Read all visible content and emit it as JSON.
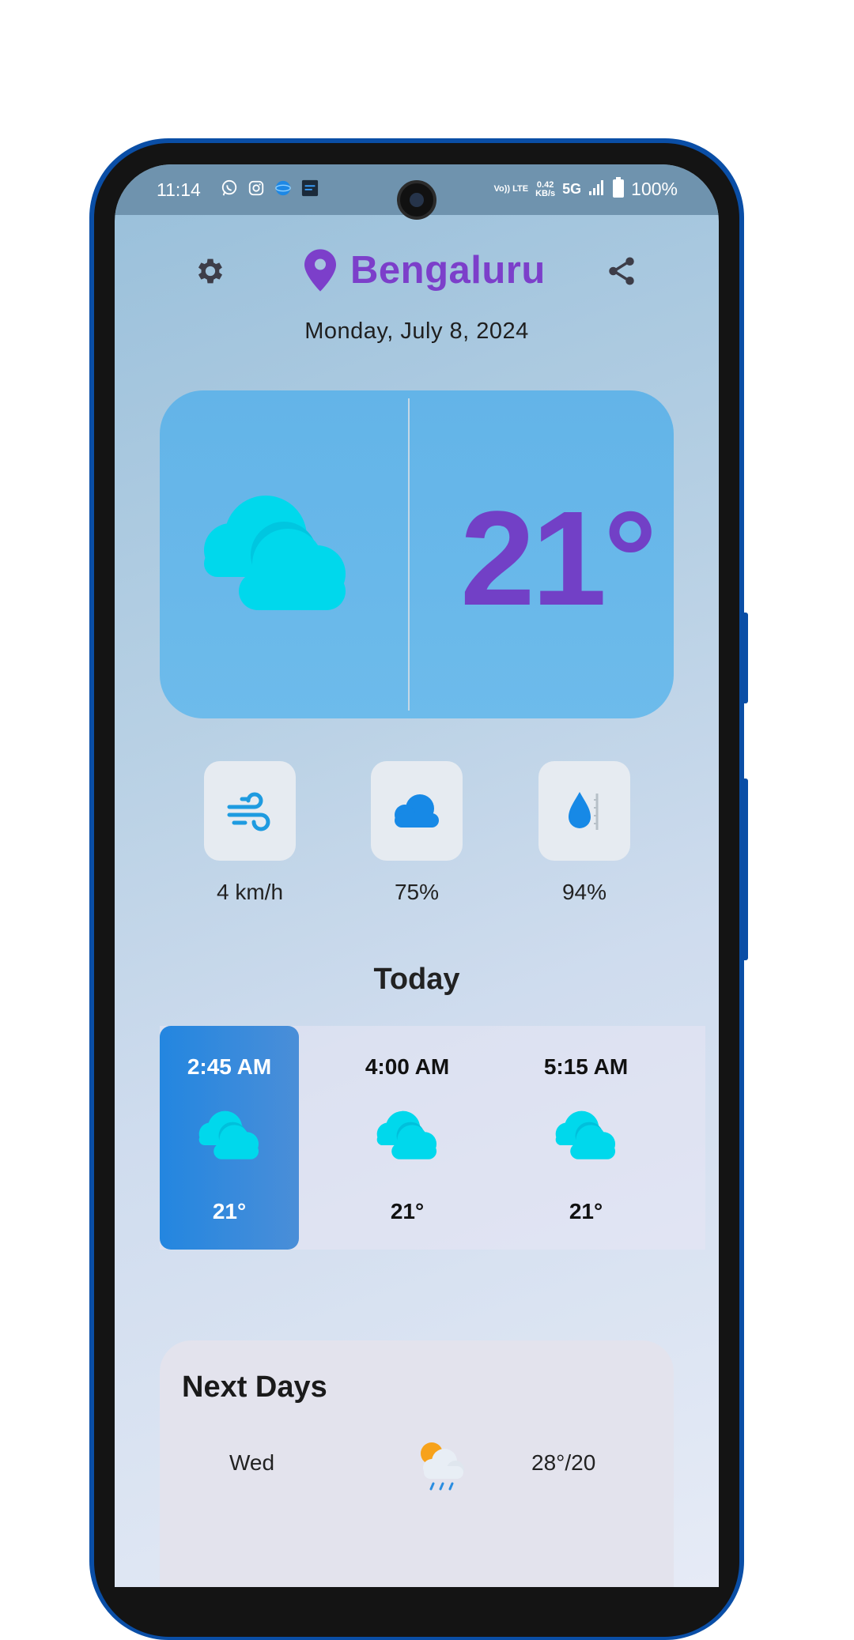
{
  "status_bar": {
    "time": "11:14",
    "volte": "Vo)) LTE",
    "speed_value": "0.42",
    "speed_unit": "KB/s",
    "network": "5G",
    "battery": "100%"
  },
  "header": {
    "city": "Bengaluru",
    "date": "Monday, July 8, 2024"
  },
  "current": {
    "temperature": "21°",
    "icon": "cloudy-icon"
  },
  "metrics": [
    {
      "icon": "wind-icon",
      "value": "4 km/h"
    },
    {
      "icon": "cloud-icon",
      "value": "75%"
    },
    {
      "icon": "humidity-icon",
      "value": "94%"
    }
  ],
  "today": {
    "title": "Today",
    "hours": [
      {
        "time": "2:45 AM",
        "temp": "21°",
        "selected": true
      },
      {
        "time": "4:00 AM",
        "temp": "21°",
        "selected": false
      },
      {
        "time": "5:15 AM",
        "temp": "21°",
        "selected": false
      }
    ]
  },
  "next_days": {
    "title": "Next Days",
    "rows": [
      {
        "day": "Wed",
        "icon": "sun-cloud-rain-icon",
        "temp": "28°/20"
      }
    ]
  },
  "colors": {
    "accent_purple": "#7c3fca",
    "card_blue": "#63b4e8",
    "selected_blue": "#2386e0",
    "cloud_cyan": "#00d8ec"
  }
}
